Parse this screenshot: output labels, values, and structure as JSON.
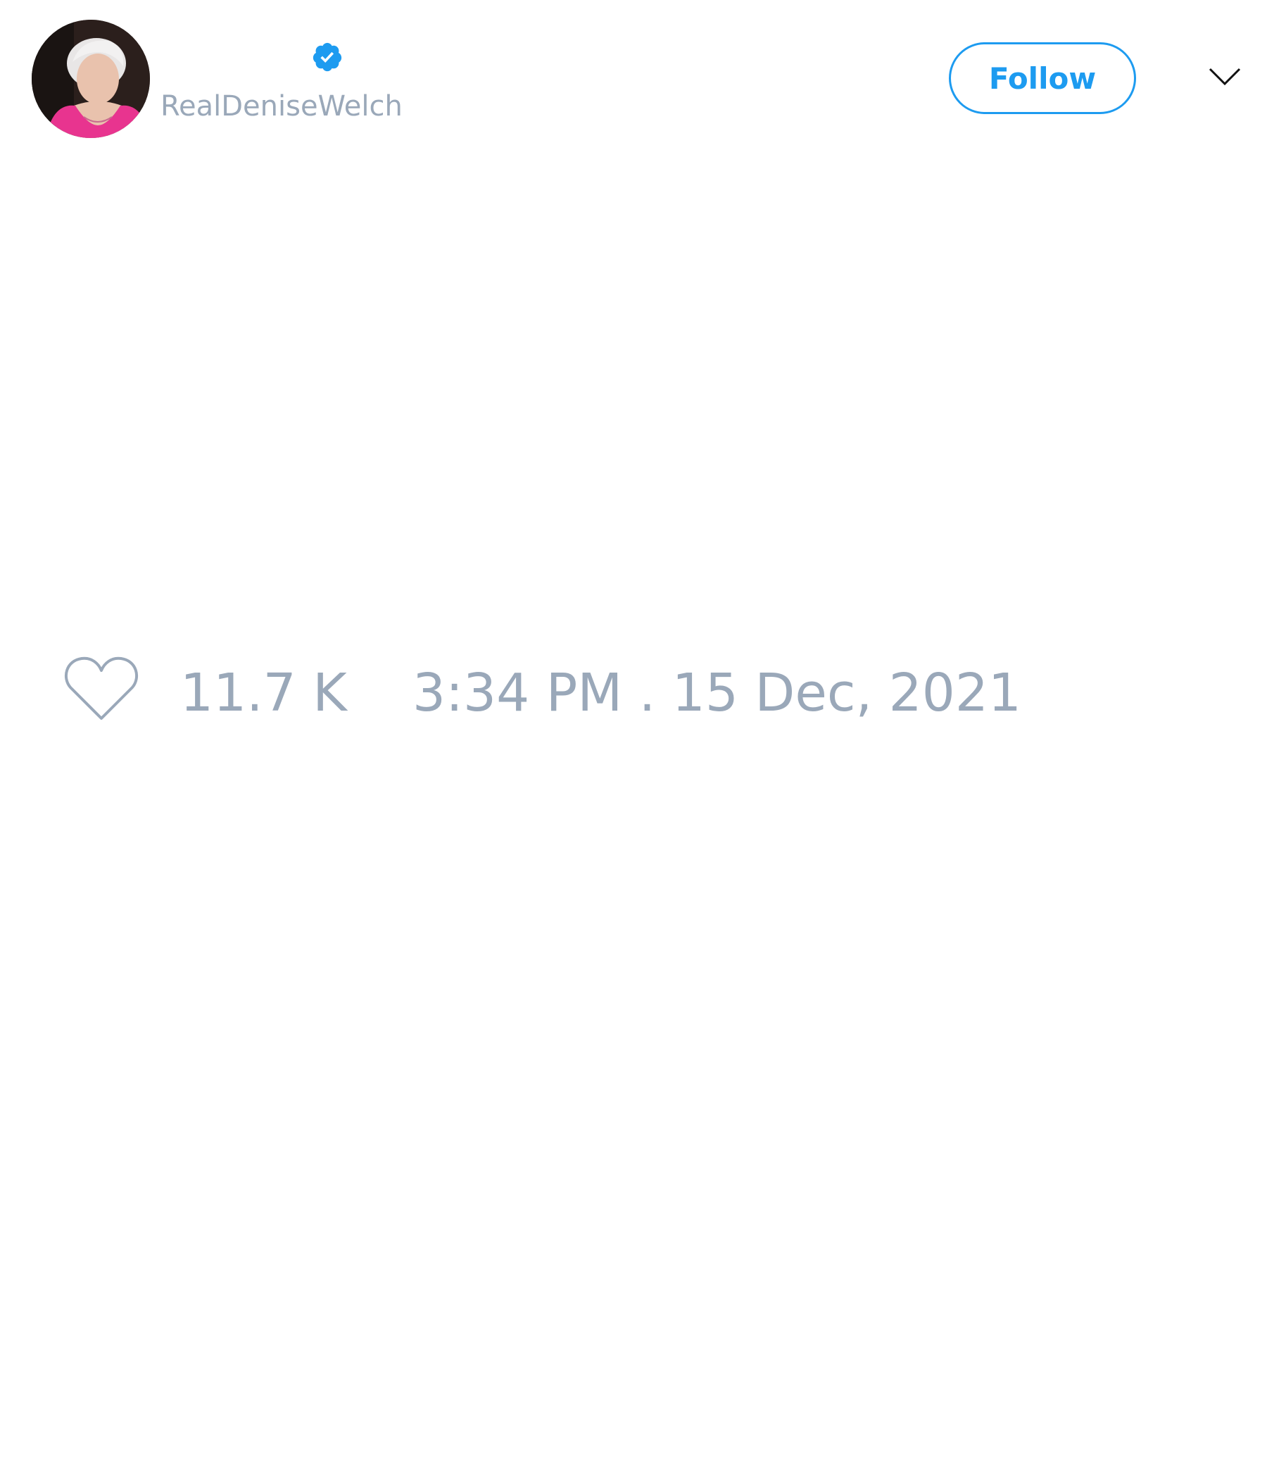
{
  "profile": {
    "handle": "RealDeniseWelch",
    "verified": true,
    "avatar_icon": "avatar-photo"
  },
  "header": {
    "follow_label": "Follow",
    "menu_icon": "chevron-down-icon"
  },
  "tweet": {
    "like_icon": "heart-icon",
    "like_count": "11.7 K",
    "timestamp": "3:34 PM . 15 Dec, 2021"
  },
  "colors": {
    "accent": "#1d9bf0",
    "muted_text": "#9aa8b9",
    "background": "#ffffff"
  }
}
